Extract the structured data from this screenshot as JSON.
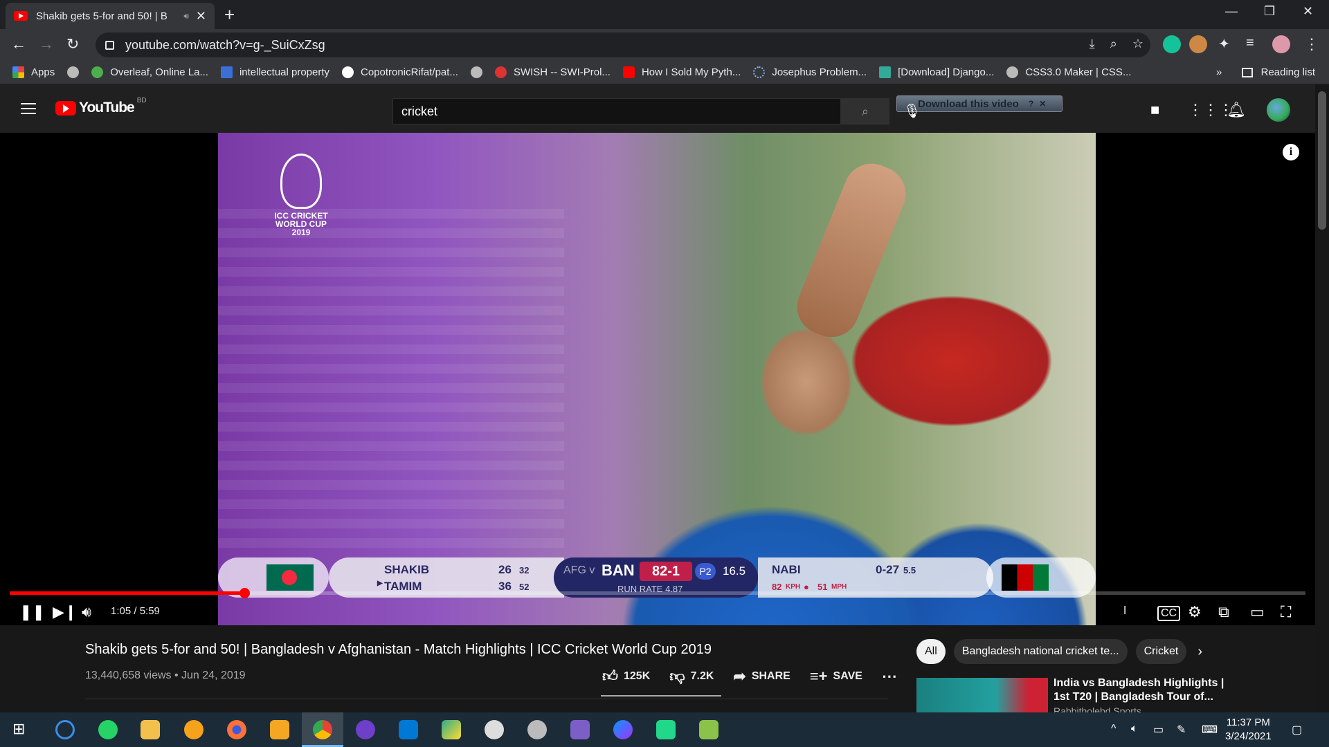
{
  "browser": {
    "tab_title": "Shakib gets 5-for and 50! | B",
    "url": "youtube.com/watch?v=g-_SuiCxZsg",
    "bookmarks": [
      "Apps",
      "Overleaf, Online La...",
      "intellectual property",
      "CopotronicRifat/pat...",
      "SWISH -- SWI-Prol...",
      "How I Sold My Pyth...",
      "Josephus Problem...",
      "[Download] Django...",
      "CSS3.0 Maker | CSS..."
    ],
    "overflow": "»",
    "reading_list": "Reading list"
  },
  "youtube": {
    "logo_text": "YouTube",
    "country": "BD",
    "search_value": "cricket",
    "download_label": "Download this video"
  },
  "video": {
    "logo_lines": [
      "ICC CRICKET",
      "WORLD CUP",
      "2019"
    ],
    "scoreboard": {
      "bat1": "SHAKIB",
      "bat1_runs": "26",
      "bat1_balls": "32",
      "bat2": "TAMIM",
      "bat2_runs": "36",
      "bat2_balls": "52",
      "teams_prefix": "AFG v",
      "team": "BAN",
      "score": "82-1",
      "powerplay": "P2",
      "overs": "16.5",
      "run_rate": "RUN RATE 4.87",
      "bowler": "NABI",
      "bowler_figures": "0-27",
      "bowler_overs": "5.5",
      "speed_kph": "82",
      "kph": "KPH",
      "speed_mph": "51",
      "mph": "MPH"
    },
    "time": "1:05 / 5:59",
    "progress": 0.181
  },
  "meta": {
    "title": "Shakib gets 5-for and 50! | Bangladesh v Afghanistan - Match Highlights | ICC Cricket World Cup 2019",
    "views_date": "13,440,658 views • Jun 24, 2019",
    "likes": "125K",
    "dislikes": "7.2K",
    "share": "SHARE",
    "save": "SAVE"
  },
  "chips": [
    "All",
    "Bangladesh national cricket te...",
    "Cricket"
  ],
  "recommendation": {
    "title": "India vs Bangladesh Highlights | 1st T20 | Bangladesh Tour of...",
    "channel": "Rabbitholebd Sports"
  },
  "clock": {
    "time": "11:37 PM",
    "date": "3/24/2021"
  }
}
